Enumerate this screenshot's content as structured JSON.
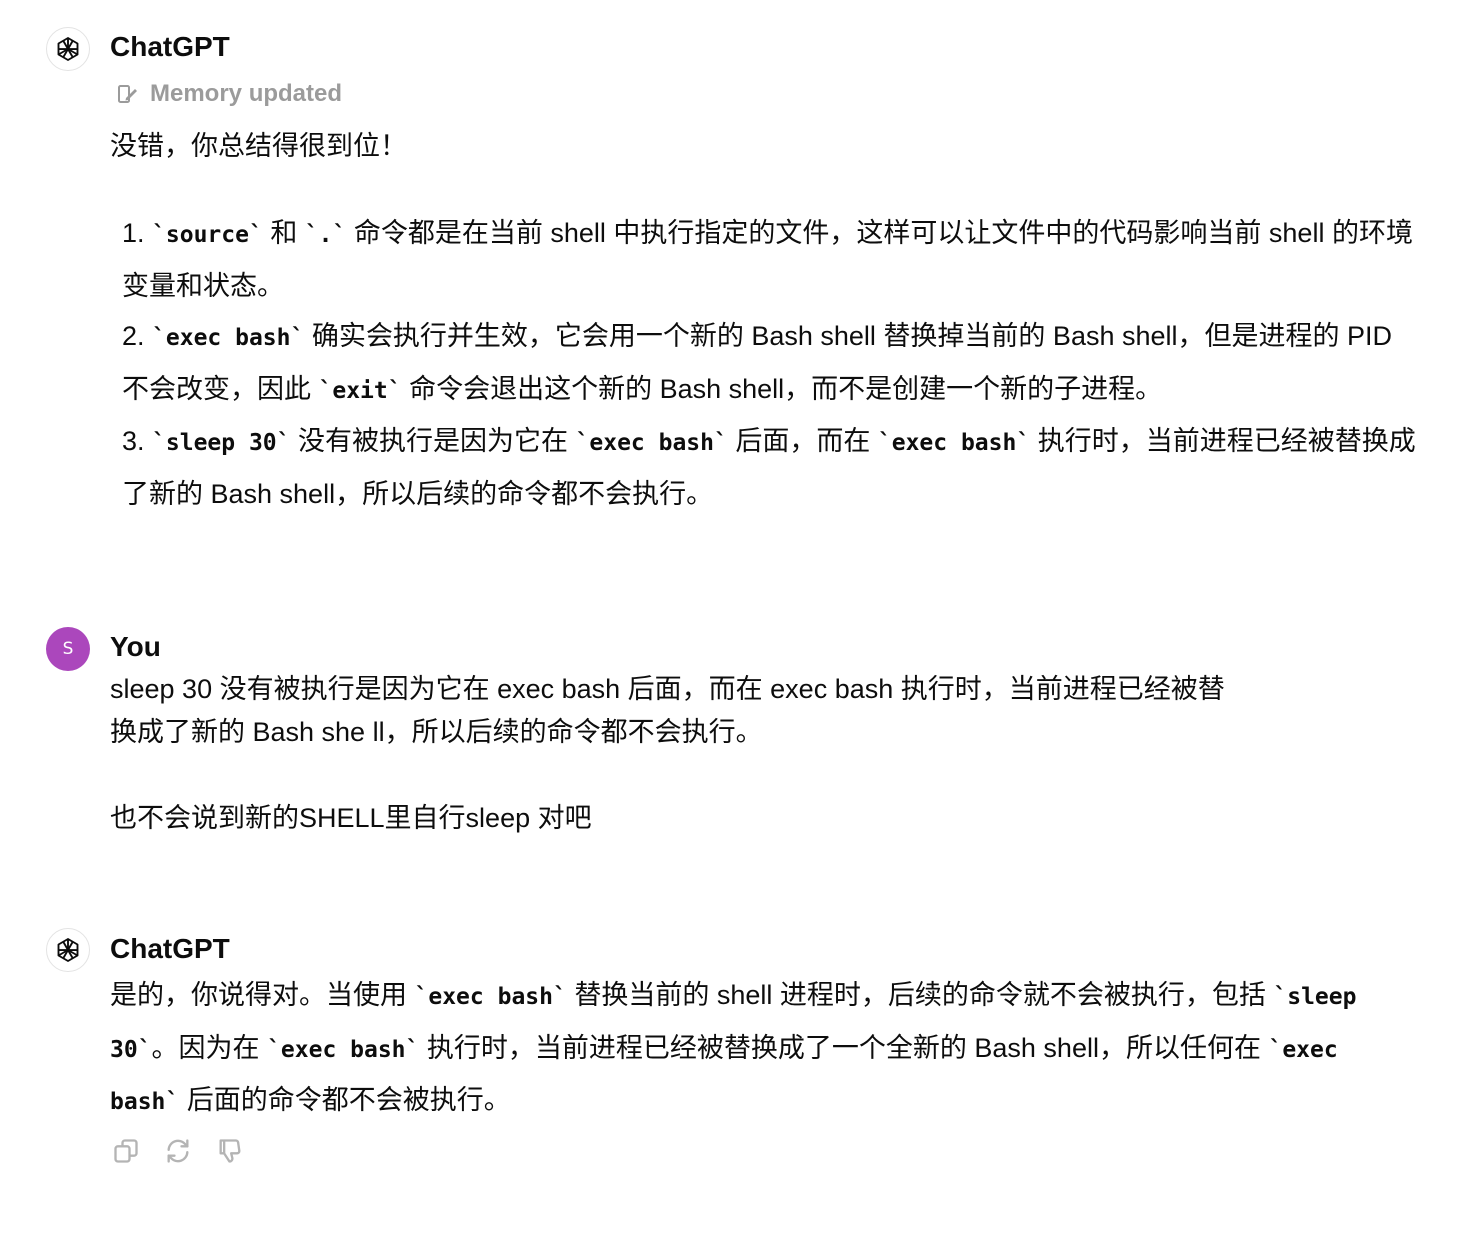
{
  "messages": [
    {
      "author": "ChatGPT",
      "memory_label": "Memory updated",
      "intro": "没错，你总结得很到位！",
      "items": [
        {
          "num": "1. ",
          "parts": [
            {
              "t": "`source`",
              "code": true
            },
            {
              "t": " 和 "
            },
            {
              "t": "`.`",
              "code": true
            },
            {
              "t": " 命令都是在当前 shell 中执行指定的文件，这样可以让文件中的代码影响当前 shell 的环境变量和状态。"
            }
          ]
        },
        {
          "num": "2. ",
          "parts": [
            {
              "t": "`exec bash`",
              "code": true
            },
            {
              "t": " 确实会执行并生效，它会用一个新的 Bash shell 替换掉当前的 Bash shell，但是进程的 PID 不会改变，因此 "
            },
            {
              "t": "`exit`",
              "code": true
            },
            {
              "t": " 命令会退出这个新的 Bash shell，而不是创建一个新的子进程。"
            }
          ]
        },
        {
          "num": "3. ",
          "parts": [
            {
              "t": "`sleep 30`",
              "code": true
            },
            {
              "t": " 没有被执行是因为它在 "
            },
            {
              "t": "`exec bash`",
              "code": true
            },
            {
              "t": " 后面，而在 "
            },
            {
              "t": "`exec bash`",
              "code": true
            },
            {
              "t": " 执行时，当前进程已经被替换成了新的 Bash shell，所以后续的命令都不会执行。"
            }
          ]
        }
      ]
    },
    {
      "author": "You",
      "avatar_letter": "S",
      "line1": "sleep 30 没有被执行是因为它在 exec bash 后面，而在 exec bash 执行时，当前进程已经被替",
      "line2": "换成了新的 Bash she ll，所以后续的命令都不会执行。",
      "line3": "也不会说到新的SHELL里自行sleep 对吧"
    },
    {
      "author": "ChatGPT",
      "parts": [
        {
          "t": "是的，你说得对。当使用 "
        },
        {
          "t": "`exec bash`",
          "code": true
        },
        {
          "t": " 替换当前的 shell 进程时，后续的命令就不会被执行，包括 "
        },
        {
          "t": "`sleep 30`",
          "code": true
        },
        {
          "t": "。因为在 "
        },
        {
          "t": "`exec bash`",
          "code": true
        },
        {
          "t": " 执行时，当前进程已经被替换成了一个全新的 Bash shell，所以任何在 "
        },
        {
          "t": "`exec bash`",
          "code": true
        },
        {
          "t": " 后面的命令都不会被执行。"
        }
      ],
      "actions": [
        "copy-icon",
        "regenerate-icon",
        "thumbs-down-icon"
      ]
    }
  ],
  "colors": {
    "user_avatar": "#ab47bc",
    "muted": "#9b9b9b",
    "text": "#0d0d0d"
  }
}
